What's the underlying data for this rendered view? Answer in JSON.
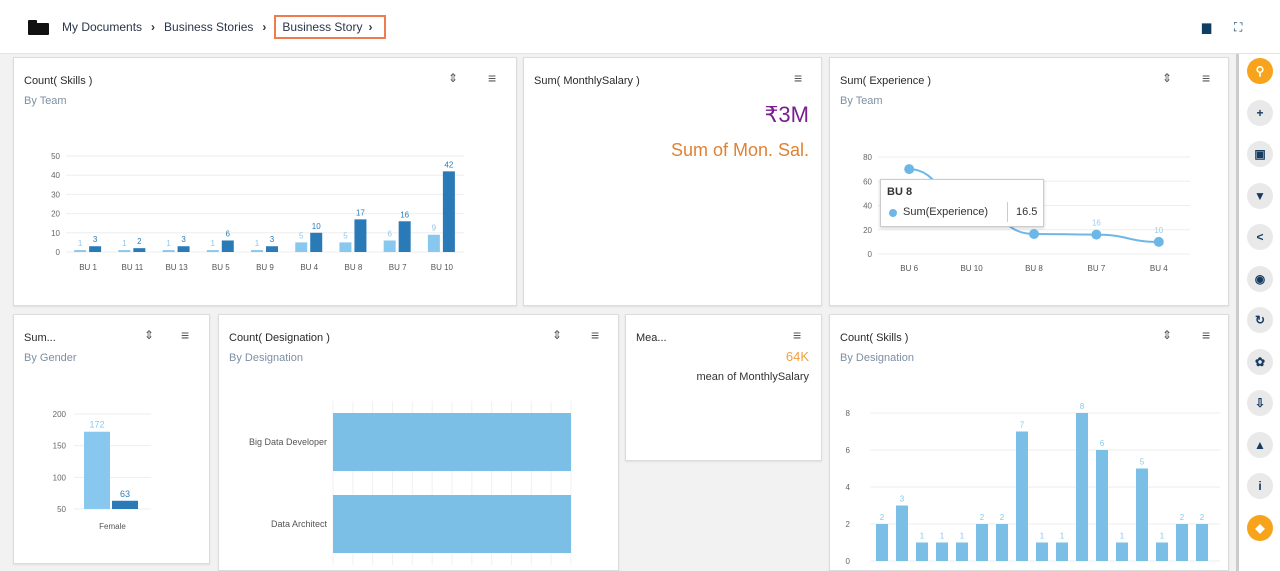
{
  "breadcrumb": {
    "items": [
      "My Documents",
      "Business Stories"
    ],
    "active": "Business Story"
  },
  "widgets": {
    "skills_team": {
      "title": "Count( Skills )",
      "subtitle": "By Team"
    },
    "salary_kpi": {
      "title": "Sum( MonthlySalary )",
      "value": "₹3M",
      "description": "Sum of Mon. Sal."
    },
    "experience_team": {
      "title": "Sum( Experience )",
      "subtitle": "By Team",
      "tooltip": {
        "title": "BU 8",
        "label": "Sum(Experience)",
        "value": "16.5"
      }
    },
    "sum_gender": {
      "title": "Sum...",
      "subtitle": "By Gender"
    },
    "designation_count": {
      "title": "Count( Designation )",
      "subtitle": "By Designation"
    },
    "mean_kpi": {
      "title": "Mea...",
      "value": "64K",
      "description": "mean of MonthlySalary"
    },
    "skills_designation": {
      "title": "Count( Skills )",
      "subtitle": "By Designation"
    }
  },
  "chart_data": [
    {
      "type": "bar",
      "categories": [
        "BU 1",
        "BU 11",
        "BU 13",
        "BU 5",
        "BU 9",
        "BU 4",
        "BU 8",
        "BU 7",
        "BU 10"
      ],
      "series": [
        {
          "values": [
            1,
            1,
            1,
            1,
            1,
            5,
            5,
            6,
            9
          ]
        },
        {
          "values": [
            3,
            2,
            3,
            6,
            3,
            10,
            17,
            16,
            42
          ]
        }
      ],
      "yticks": [
        0,
        10,
        20,
        30,
        40,
        50
      ],
      "ylim": [
        0,
        50
      ],
      "colors": [
        "#89c8ee",
        "#2a7ab8"
      ]
    },
    {
      "type": "line",
      "categories": [
        "BU 6",
        "BU 10",
        "BU 8",
        "BU 7",
        "BU 4"
      ],
      "values": [
        70,
        38,
        16.5,
        16,
        10
      ],
      "data_labels": [
        "",
        "",
        "",
        "16",
        "10"
      ],
      "yticks": [
        0,
        20,
        40,
        60,
        80
      ],
      "ylim": [
        0,
        80
      ],
      "color": "#6db7e6"
    },
    {
      "type": "bar",
      "categories": [
        "Female"
      ],
      "series": [
        {
          "values": [
            172
          ]
        },
        {
          "values": [
            63
          ]
        }
      ],
      "yticks": [
        50,
        100,
        150,
        200
      ],
      "ylim": [
        50,
        200
      ],
      "colors": [
        "#89c8ee",
        "#2a7ab8"
      ]
    },
    {
      "type": "bar",
      "orientation": "horizontal",
      "categories": [
        "Big Data Developer",
        "Data Architect"
      ],
      "values": [
        1,
        1
      ],
      "color": "#7bbfe6"
    },
    {
      "type": "bar",
      "values": [
        2,
        3,
        1,
        1,
        1,
        2,
        2,
        7,
        1,
        1,
        8,
        6,
        1,
        5,
        1,
        2,
        2
      ],
      "yticks": [
        0,
        2,
        4,
        6,
        8
      ],
      "ylim": [
        0,
        8
      ],
      "color": "#7bbfe6"
    }
  ],
  "icons": {
    "folder": "folder-icon",
    "comment": "comment-icon",
    "expand": "expand-icon",
    "sort": "sort-icon",
    "menu": "menu-icon"
  },
  "sidebar_tools": [
    {
      "name": "search",
      "glyph": "⚲"
    },
    {
      "name": "add",
      "glyph": "+"
    },
    {
      "name": "save",
      "glyph": "▣"
    },
    {
      "name": "filter",
      "glyph": "▼"
    },
    {
      "name": "share",
      "glyph": "<"
    },
    {
      "name": "preview",
      "glyph": "◉"
    },
    {
      "name": "refresh",
      "glyph": "↻"
    },
    {
      "name": "settings",
      "glyph": "✿"
    },
    {
      "name": "export",
      "glyph": "⇩"
    },
    {
      "name": "alert",
      "glyph": "▲"
    },
    {
      "name": "info",
      "glyph": "i"
    },
    {
      "name": "tips",
      "glyph": "◆"
    }
  ]
}
